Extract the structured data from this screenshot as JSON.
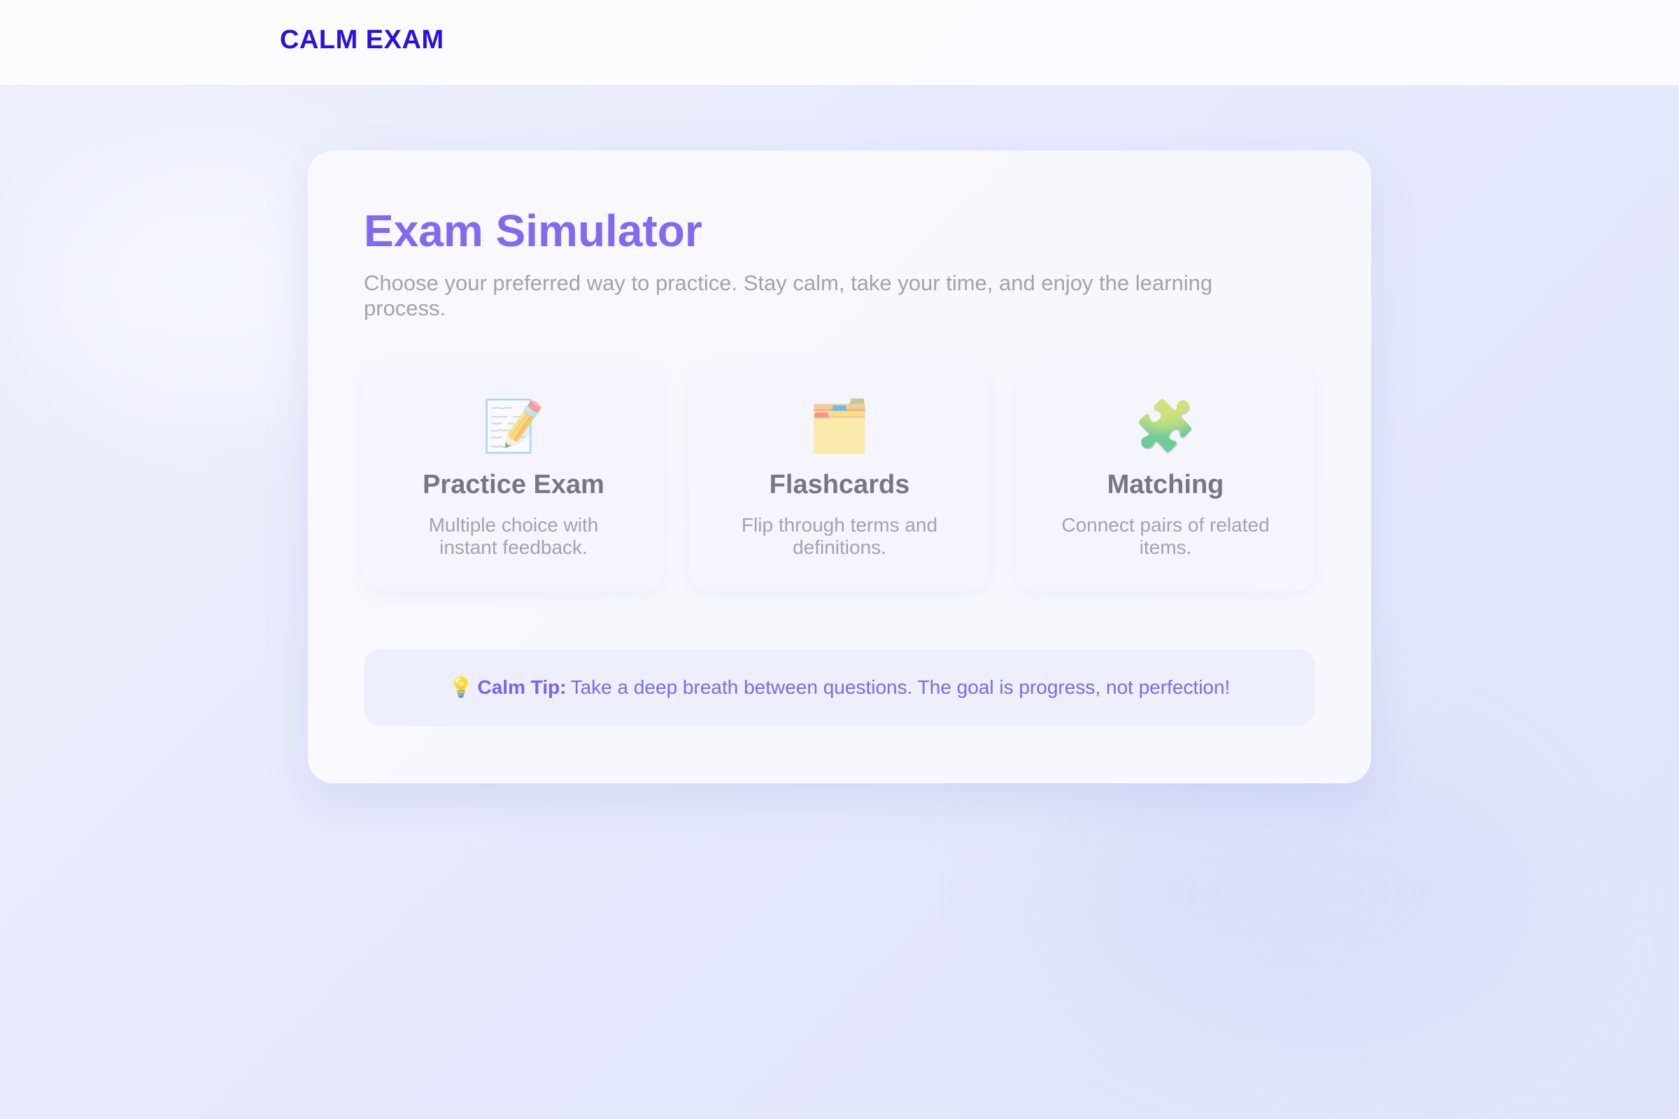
{
  "header": {
    "brand": "CALM EXAM"
  },
  "main": {
    "title": "Exam Simulator",
    "subtitle": "Choose your preferred way to practice. Stay calm, take your time, and enjoy the learning process.",
    "modes": [
      {
        "icon": "📝",
        "icon_name": "memo-pencil-icon",
        "title": "Practice Exam",
        "description": "Multiple choice with instant feedback."
      },
      {
        "icon": "🗂️",
        "icon_name": "card-index-dividers-icon",
        "title": "Flashcards",
        "description": "Flip through terms and definitions."
      },
      {
        "icon": "🧩",
        "icon_name": "puzzle-piece-icon",
        "title": "Matching",
        "description": "Connect pairs of related items."
      }
    ],
    "tip": {
      "icon": "💡",
      "icon_name": "lightbulb-icon",
      "label": "Calm Tip:",
      "text": "Take a deep breath between questions. The goal is progress, not perfection!"
    }
  },
  "colors": {
    "brand": "#2a0fe6",
    "title": "#8468f0",
    "tip_text": "#7b6aea",
    "muted_text": "#a3a4aa",
    "card_title": "#77787f",
    "background": "#e6e9fc"
  }
}
